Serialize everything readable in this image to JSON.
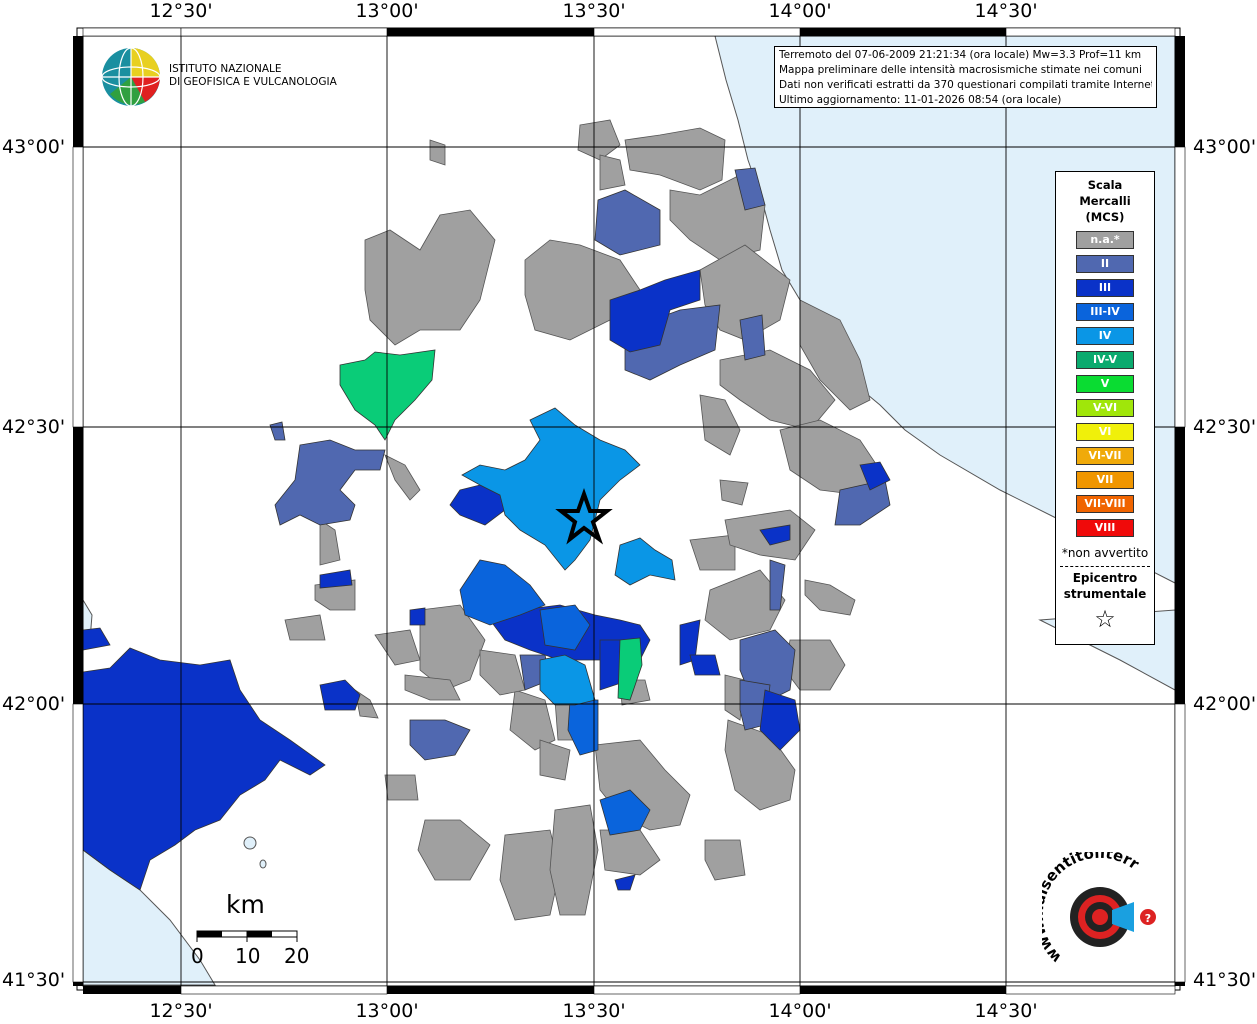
{
  "map": {
    "axes": {
      "top_ticks": [
        "12°30'",
        "13°00'",
        "13°30'",
        "14°00'",
        "14°30'"
      ],
      "bottom_ticks": [
        "12°30'",
        "13°00'",
        "13°30'",
        "14°00'",
        "14°30'"
      ],
      "left_ticks": [
        "43°00'",
        "42°30'",
        "42°00'",
        "41°30'"
      ],
      "right_ticks": [
        "43°00'",
        "42°30'",
        "42°00'",
        "41°30'"
      ]
    },
    "info": {
      "line1": "Terremoto del 07-06-2009 21:21:34 (ora locale) Mw=3.3 Prof=11 km",
      "line2": "Mappa preliminare delle intensità macrosismiche stimate nei comuni",
      "line3": "Dati non verificati estratti da 370 questionari compilati tramite Internet.",
      "line4": "Ultimo aggiornamento: 11-01-2026 08:54 (ora locale)"
    },
    "logo": {
      "line1": "ISTITUTO NAZIONALE",
      "line2": "DI GEOFISICA E VULCANOLOGIA"
    },
    "legend": {
      "title1": "Scala",
      "title2": "Mercalli",
      "title3": "(MCS)",
      "items": [
        {
          "label": "n.a.*",
          "color": "#a0a0a0"
        },
        {
          "label": "II",
          "color": "#5068b0"
        },
        {
          "label": "III",
          "color": "#0a32c8"
        },
        {
          "label": "III-IV",
          "color": "#0a64dc"
        },
        {
          "label": "IV",
          "color": "#0a96e6"
        },
        {
          "label": "IV-V",
          "color": "#0aaa6e"
        },
        {
          "label": "V",
          "color": "#0adc32"
        },
        {
          "label": "V-VI",
          "color": "#a0e60a"
        },
        {
          "label": "VI",
          "color": "#f0f00a"
        },
        {
          "label": "VI-VII",
          "color": "#f0aa0a"
        },
        {
          "label": "VII",
          "color": "#f09600"
        },
        {
          "label": "VII-VIII",
          "color": "#f06400"
        },
        {
          "label": "VIII",
          "color": "#f00a0a"
        }
      ],
      "na_note": "*non avvertito",
      "epicenter1": "Epicentro",
      "epicenter2": "strumentale",
      "star": "☆"
    },
    "scale_bar": {
      "unit": "km",
      "labels": [
        "0",
        "10",
        "20"
      ]
    },
    "watermark": {
      "text": "www.haisentitoilterremoto.it"
    },
    "epicenter": {
      "lon": "13°28'",
      "lat": "42°21'"
    },
    "colors": {
      "sea": "#e0f0fa",
      "gray": "#a0a0a0",
      "ii": "#5068b0",
      "iii": "#0a32c8",
      "iii_iv": "#0a64dc",
      "iv": "#0a96e6",
      "iv_v": "#0acc78"
    }
  }
}
